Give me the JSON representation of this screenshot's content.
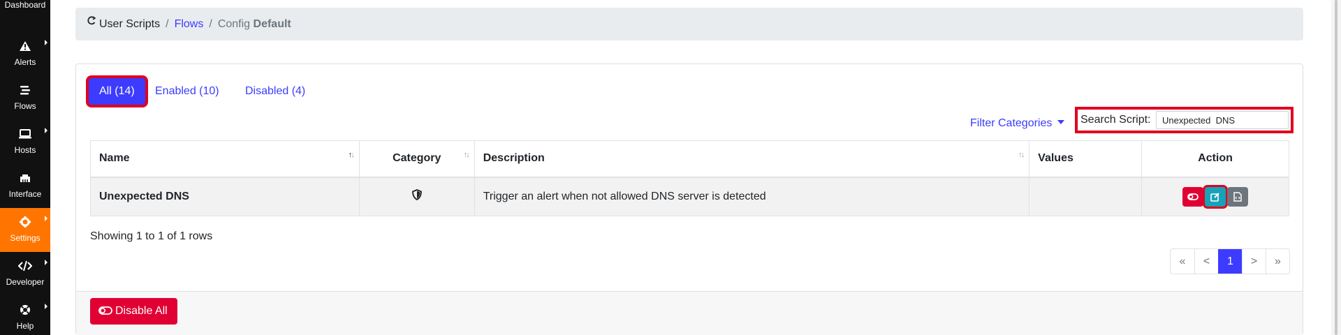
{
  "sidebar": {
    "items": [
      {
        "label": "Dashboard",
        "icon": "dashboard-icon"
      },
      {
        "label": "Alerts",
        "icon": "warning-icon"
      },
      {
        "label": "Flows",
        "icon": "stream-icon"
      },
      {
        "label": "Hosts",
        "icon": "laptop-icon"
      },
      {
        "label": "Interface",
        "icon": "ethernet-icon"
      },
      {
        "label": "Settings",
        "icon": "gear-icon",
        "active": true
      },
      {
        "label": "Developer",
        "icon": "code-icon"
      },
      {
        "label": "Help",
        "icon": "life-ring-icon"
      }
    ]
  },
  "breadcrumb": {
    "root": "User Scripts",
    "separator": "/",
    "link": "Flows",
    "config_prefix": "Config",
    "config_name": "Default"
  },
  "tabs": [
    {
      "label": "All (14)",
      "active": true
    },
    {
      "label": "Enabled (10)",
      "active": false
    },
    {
      "label": "Disabled (4)",
      "active": false
    }
  ],
  "filter": {
    "label": "Filter Categories"
  },
  "search": {
    "label": "Search Script:",
    "value": "Unexpected  DNS"
  },
  "table": {
    "headers": {
      "name": "Name",
      "category": "Category",
      "description": "Description",
      "values": "Values",
      "action": "Action"
    },
    "rows": [
      {
        "name": "Unexpected DNS",
        "category_icon": "shield-icon",
        "description": "Trigger an alert when not allowed DNS server is detected",
        "values": ""
      }
    ]
  },
  "showing": "Showing 1 to 1 of 1 rows",
  "pagination": {
    "first": "«",
    "prev": "<",
    "current": "1",
    "next": ">",
    "last": "»"
  },
  "footer": {
    "disable_all": "Disable All"
  },
  "colors": {
    "primary": "#3d3bff",
    "danger": "#e00034",
    "info": "#17a2b8",
    "secondary": "#6c757d",
    "sidebar_active": "#ff7500",
    "highlight": "#e0001f"
  }
}
